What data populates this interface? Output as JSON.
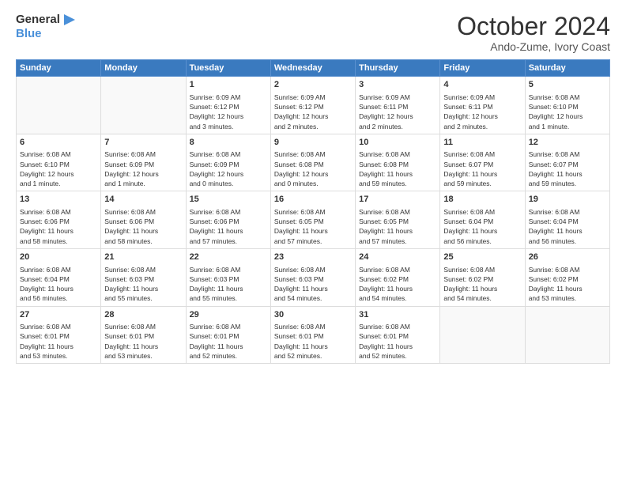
{
  "logo": {
    "line1": "General",
    "line2": "Blue"
  },
  "title": "October 2024",
  "subtitle": "Ando-Zume, Ivory Coast",
  "days_header": [
    "Sunday",
    "Monday",
    "Tuesday",
    "Wednesday",
    "Thursday",
    "Friday",
    "Saturday"
  ],
  "weeks": [
    [
      {
        "num": "",
        "info": ""
      },
      {
        "num": "",
        "info": ""
      },
      {
        "num": "1",
        "info": "Sunrise: 6:09 AM\nSunset: 6:12 PM\nDaylight: 12 hours\nand 3 minutes."
      },
      {
        "num": "2",
        "info": "Sunrise: 6:09 AM\nSunset: 6:12 PM\nDaylight: 12 hours\nand 2 minutes."
      },
      {
        "num": "3",
        "info": "Sunrise: 6:09 AM\nSunset: 6:11 PM\nDaylight: 12 hours\nand 2 minutes."
      },
      {
        "num": "4",
        "info": "Sunrise: 6:09 AM\nSunset: 6:11 PM\nDaylight: 12 hours\nand 2 minutes."
      },
      {
        "num": "5",
        "info": "Sunrise: 6:08 AM\nSunset: 6:10 PM\nDaylight: 12 hours\nand 1 minute."
      }
    ],
    [
      {
        "num": "6",
        "info": "Sunrise: 6:08 AM\nSunset: 6:10 PM\nDaylight: 12 hours\nand 1 minute."
      },
      {
        "num": "7",
        "info": "Sunrise: 6:08 AM\nSunset: 6:09 PM\nDaylight: 12 hours\nand 1 minute."
      },
      {
        "num": "8",
        "info": "Sunrise: 6:08 AM\nSunset: 6:09 PM\nDaylight: 12 hours\nand 0 minutes."
      },
      {
        "num": "9",
        "info": "Sunrise: 6:08 AM\nSunset: 6:08 PM\nDaylight: 12 hours\nand 0 minutes."
      },
      {
        "num": "10",
        "info": "Sunrise: 6:08 AM\nSunset: 6:08 PM\nDaylight: 11 hours\nand 59 minutes."
      },
      {
        "num": "11",
        "info": "Sunrise: 6:08 AM\nSunset: 6:07 PM\nDaylight: 11 hours\nand 59 minutes."
      },
      {
        "num": "12",
        "info": "Sunrise: 6:08 AM\nSunset: 6:07 PM\nDaylight: 11 hours\nand 59 minutes."
      }
    ],
    [
      {
        "num": "13",
        "info": "Sunrise: 6:08 AM\nSunset: 6:06 PM\nDaylight: 11 hours\nand 58 minutes."
      },
      {
        "num": "14",
        "info": "Sunrise: 6:08 AM\nSunset: 6:06 PM\nDaylight: 11 hours\nand 58 minutes."
      },
      {
        "num": "15",
        "info": "Sunrise: 6:08 AM\nSunset: 6:06 PM\nDaylight: 11 hours\nand 57 minutes."
      },
      {
        "num": "16",
        "info": "Sunrise: 6:08 AM\nSunset: 6:05 PM\nDaylight: 11 hours\nand 57 minutes."
      },
      {
        "num": "17",
        "info": "Sunrise: 6:08 AM\nSunset: 6:05 PM\nDaylight: 11 hours\nand 57 minutes."
      },
      {
        "num": "18",
        "info": "Sunrise: 6:08 AM\nSunset: 6:04 PM\nDaylight: 11 hours\nand 56 minutes."
      },
      {
        "num": "19",
        "info": "Sunrise: 6:08 AM\nSunset: 6:04 PM\nDaylight: 11 hours\nand 56 minutes."
      }
    ],
    [
      {
        "num": "20",
        "info": "Sunrise: 6:08 AM\nSunset: 6:04 PM\nDaylight: 11 hours\nand 56 minutes."
      },
      {
        "num": "21",
        "info": "Sunrise: 6:08 AM\nSunset: 6:03 PM\nDaylight: 11 hours\nand 55 minutes."
      },
      {
        "num": "22",
        "info": "Sunrise: 6:08 AM\nSunset: 6:03 PM\nDaylight: 11 hours\nand 55 minutes."
      },
      {
        "num": "23",
        "info": "Sunrise: 6:08 AM\nSunset: 6:03 PM\nDaylight: 11 hours\nand 54 minutes."
      },
      {
        "num": "24",
        "info": "Sunrise: 6:08 AM\nSunset: 6:02 PM\nDaylight: 11 hours\nand 54 minutes."
      },
      {
        "num": "25",
        "info": "Sunrise: 6:08 AM\nSunset: 6:02 PM\nDaylight: 11 hours\nand 54 minutes."
      },
      {
        "num": "26",
        "info": "Sunrise: 6:08 AM\nSunset: 6:02 PM\nDaylight: 11 hours\nand 53 minutes."
      }
    ],
    [
      {
        "num": "27",
        "info": "Sunrise: 6:08 AM\nSunset: 6:01 PM\nDaylight: 11 hours\nand 53 minutes."
      },
      {
        "num": "28",
        "info": "Sunrise: 6:08 AM\nSunset: 6:01 PM\nDaylight: 11 hours\nand 53 minutes."
      },
      {
        "num": "29",
        "info": "Sunrise: 6:08 AM\nSunset: 6:01 PM\nDaylight: 11 hours\nand 52 minutes."
      },
      {
        "num": "30",
        "info": "Sunrise: 6:08 AM\nSunset: 6:01 PM\nDaylight: 11 hours\nand 52 minutes."
      },
      {
        "num": "31",
        "info": "Sunrise: 6:08 AM\nSunset: 6:01 PM\nDaylight: 11 hours\nand 52 minutes."
      },
      {
        "num": "",
        "info": ""
      },
      {
        "num": "",
        "info": ""
      }
    ]
  ]
}
